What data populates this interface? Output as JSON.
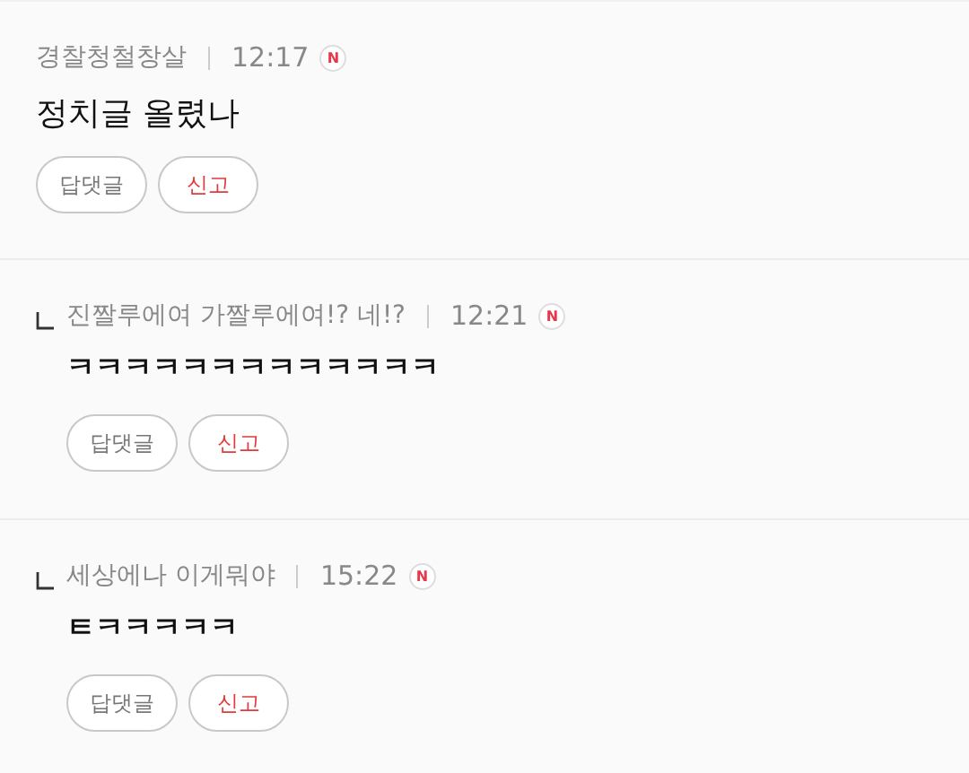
{
  "comments": [
    {
      "kind": "comment",
      "author": "경찰청철창살",
      "time": "12:17",
      "badge": "N",
      "text": "정치글 올렸나",
      "buttons": [
        "답댓글",
        "신고"
      ]
    },
    {
      "kind": "reply",
      "author": "진짤루에여 가짤루에여!? 네!?",
      "time": "12:21",
      "badge": "N",
      "text": "ㅋㅋㅋㅋㅋㅋㅋㅋㅋㅋㅋㅋㅋ",
      "buttons": [
        "답댓글",
        "신고"
      ]
    },
    {
      "kind": "reply",
      "author": "세상에나 이게뭐야",
      "time": "15:22",
      "badge": "N",
      "text": "ㅌㅋㅋㅋㅋㅋ",
      "buttons": [
        "답댓글",
        "신고"
      ]
    }
  ]
}
